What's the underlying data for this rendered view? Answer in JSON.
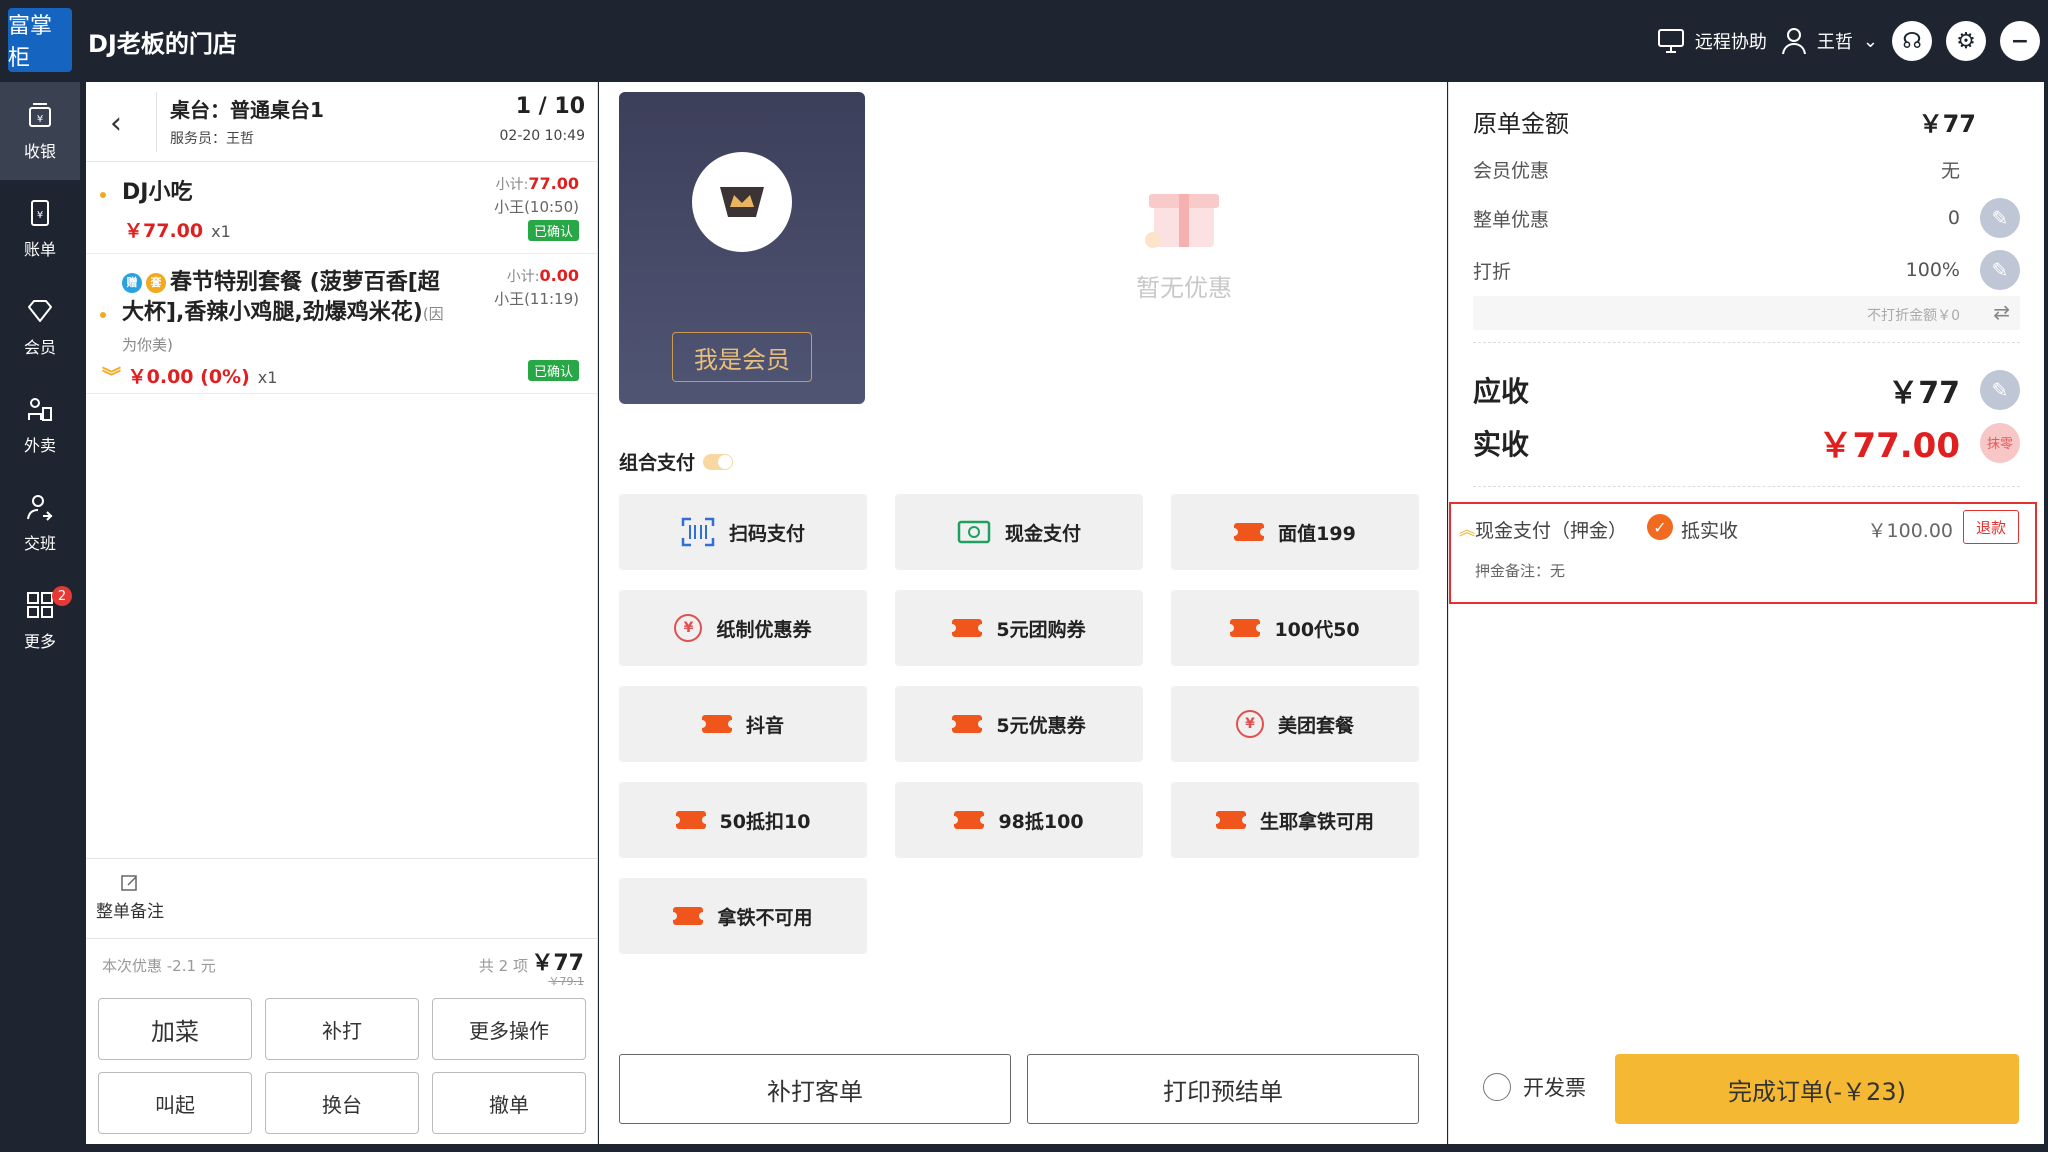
{
  "app": {
    "logo_text": "富掌柜",
    "store_name": "DJ老板的门店",
    "remote_help": "远程协助",
    "user": "王哲"
  },
  "sidebar": {
    "items": [
      {
        "label": "收银",
        "icon": "cashier-icon"
      },
      {
        "label": "账单",
        "icon": "bill-icon"
      },
      {
        "label": "会员",
        "icon": "member-icon"
      },
      {
        "label": "外卖",
        "icon": "delivery-icon"
      },
      {
        "label": "交班",
        "icon": "handover-icon"
      },
      {
        "label": "更多",
        "icon": "more-icon",
        "badge": "2"
      }
    ]
  },
  "order": {
    "table_title": "桌台：普通桌台1",
    "waiter": "服务员：王哲",
    "page_count": "1 / 10",
    "time": "02-20 10:49",
    "items": [
      {
        "name": "DJ小吃",
        "price": "￥77.00",
        "qty": "x1",
        "subtotal_label": "小计:",
        "subtotal": "77.00",
        "waiter_time": "小王(10:50)",
        "status": "已确认"
      },
      {
        "badge_gift": "赠",
        "badge_set": "套",
        "name": "春节特别套餐 (菠萝百香[超大杯],香辣小鸡腿,劲爆鸡米花)",
        "note": "(因为你美)",
        "price": "￥0.00 (0%)",
        "qty": "x1",
        "subtotal_label": "小计:",
        "subtotal": "0.00",
        "waiter_time": "小王(11:19)",
        "status": "已确认"
      }
    ],
    "remark_label": "整单备注",
    "discount_text": "本次优惠 -2.1 元",
    "count_text": "共 2 项",
    "total": "￥77",
    "original_total": "￥79.1",
    "actions": [
      "加菜",
      "补打",
      "更多操作",
      "叫起",
      "换台",
      "撤单"
    ]
  },
  "payment": {
    "member_button": "我是会员",
    "no_promo": "暂无优惠",
    "combo_label": "组合支付",
    "methods": [
      {
        "label": "扫码支付",
        "icon": "scan-icon"
      },
      {
        "label": "现金支付",
        "icon": "cash-icon"
      },
      {
        "label": "面值199",
        "icon": "ticket-icon"
      },
      {
        "label": "纸制优惠券",
        "icon": "coin-icon"
      },
      {
        "label": "5元团购券",
        "icon": "ticket-icon"
      },
      {
        "label": "100代50",
        "icon": "ticket-icon"
      },
      {
        "label": "抖音",
        "icon": "ticket-icon"
      },
      {
        "label": "5元优惠券",
        "icon": "ticket-icon"
      },
      {
        "label": "美团套餐",
        "icon": "coin-icon"
      },
      {
        "label": "50抵扣10",
        "icon": "ticket-icon"
      },
      {
        "label": "98抵100",
        "icon": "ticket-icon"
      },
      {
        "label": "生耶拿铁可用",
        "icon": "ticket-icon"
      },
      {
        "label": "拿铁不可用",
        "icon": "ticket-icon"
      }
    ],
    "reprint_button": "补打客单",
    "print_pre_button": "打印预结单"
  },
  "summary": {
    "original_label": "原单金额",
    "original_value": "￥77",
    "member_label": "会员优惠",
    "member_value": "无",
    "whole_label": "整单优惠",
    "whole_value": "0",
    "discount_label": "打折",
    "discount_value": "100%",
    "no_discount_text": "不打折金额￥0",
    "due_label": "应收",
    "due_value": "￥77",
    "paid_label": "实收",
    "paid_value": "￥77.00",
    "round_label": "抹零",
    "record": {
      "method": "现金支付（押金）",
      "offset_label": "抵实收",
      "amount": "￥100.00",
      "refund": "退款",
      "note": "押金备注：无"
    },
    "invoice_label": "开发票",
    "finish_button": "完成订单(-￥23)"
  }
}
